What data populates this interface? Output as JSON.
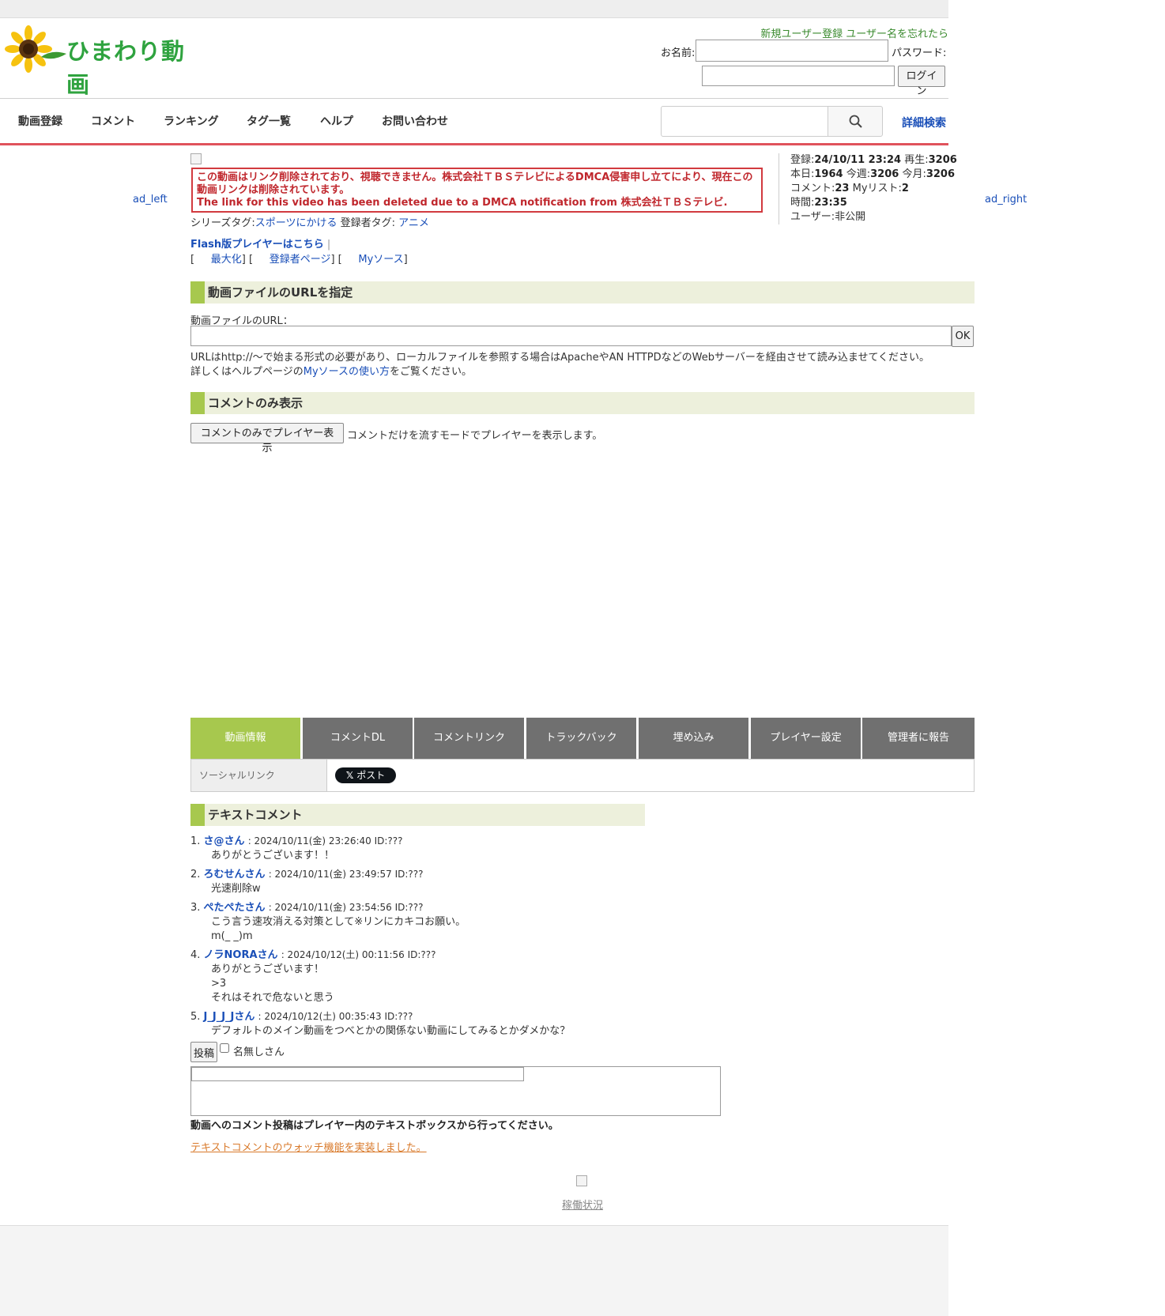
{
  "header": {
    "logo_text": "ひまわり動画",
    "register_link": "新規ユーザー登録",
    "forgot_link": "ユーザー名を忘れたら",
    "name_label": "お名前:",
    "password_label": "パスワード:",
    "login_button": "ログイン"
  },
  "nav": {
    "items": [
      "動画登録",
      "コメント",
      "ランキング",
      "タグ一覧",
      "ヘルプ",
      "お問い合わせ"
    ],
    "search_placeholder": "",
    "advanced_search": "詳細検索"
  },
  "ads": {
    "left": "ad_left",
    "right": "ad_right"
  },
  "notice": {
    "jp": "この動画はリンク削除されており、視聴できません。株式会社ＴＢＳテレビによるDMCA侵害申し立てにより、現在この動画リンクは削除されています。",
    "en": "The link for this video has been deleted due to a DMCA notification from 株式会社ＴＢＳテレビ."
  },
  "tags": {
    "series_label": "シリーズタグ:",
    "series_value": "スポーツにかける",
    "owner_label": "登録者タグ:",
    "owner_value": "アニメ"
  },
  "links": {
    "flash": "Flash版プレイヤーはこちら",
    "sep": "|",
    "maximize": "最大化",
    "owner_page": "登録者ページ",
    "mysource": "Myソース"
  },
  "stats": {
    "registered_label": "登録:",
    "registered": "24/10/11 23:24",
    "plays_label": "再生:",
    "plays": "3206",
    "today_label": "本日:",
    "today": "1964",
    "week_label": "今週:",
    "week": "3206",
    "month_label": "今月:",
    "month": "3206",
    "comments_label": "コメント:",
    "comments": "23",
    "mylist_label": "Myリスト:",
    "mylist": "2",
    "time_label": "時間:",
    "time": "23:35",
    "user_label": "ユーザー:",
    "user": "非公開"
  },
  "url_section": {
    "title": "動画ファイルのURLを指定",
    "label": "動画ファイルのURL：",
    "ok": "OK",
    "note1": "URLはhttp://～で始まる形式の必要があり、ローカルファイルを参照する場合はApacheやAN HTTPDなどのWebサーバーを経由させて読み込ませてください。",
    "note2_pre": "詳しくはヘルプページの",
    "note2_link": "Myソースの使い方",
    "note2_post": "をご覧ください。"
  },
  "comment_only": {
    "title": "コメントのみ表示",
    "button": "コメントのみでプレイヤー表示",
    "desc": "コメントだけを流すモードでプレイヤーを表示します。"
  },
  "tabs": [
    "動画情報",
    "コメントDL",
    "コメントリンク",
    "トラックバック",
    "埋め込み",
    "プレイヤー設定",
    "管理者に報告"
  ],
  "social": {
    "label": "ソーシャルリンク",
    "post_button": "ポスト"
  },
  "text_comments": {
    "title": "テキストコメント",
    "items": [
      {
        "num": "1.",
        "name": "さ@さん",
        "meta": ": 2024/10/11(金) 23:26:40 ID:???",
        "lines": [
          "ありがとうございます！！"
        ]
      },
      {
        "num": "2.",
        "name": "ろむせんさん",
        "meta": ": 2024/10/11(金) 23:49:57 ID:???",
        "lines": [
          "光速削除w"
        ]
      },
      {
        "num": "3.",
        "name": "ぺたぺたさん",
        "meta": ": 2024/10/11(金) 23:54:56 ID:???",
        "lines": [
          "こう言う速攻消える対策として※リンにカキコお願い。",
          "m(_ _)m"
        ]
      },
      {
        "num": "4.",
        "name": "ノラNORAさん",
        "meta": ": 2024/10/12(土) 00:11:56 ID:???",
        "lines": [
          "ありがとうございます！",
          ">3",
          "それはそれで危ないと思う"
        ]
      },
      {
        "num": "5.",
        "name": "J_J_J_Jさん",
        "meta": ": 2024/10/12(土) 00:35:43 ID:???",
        "lines": [
          "デフォルトのメイン動画をつべとかの関係ない動画にしてみるとかダメかな？"
        ]
      }
    ],
    "post_button": "投稿",
    "anon_label": "名無しさん",
    "note": "動画へのコメント投稿はプレイヤー内のテキストボックスから行ってください。",
    "watch_link": "テキストコメントのウォッチ機能を実装しました。"
  },
  "footer": {
    "status_link": "稼働状況"
  },
  "colors": {
    "accent_green": "#a7c84e",
    "nav_red": "#e0535c",
    "notice_red": "#c0272d",
    "link_blue": "#1a4fb8",
    "tab_gray": "#707070"
  }
}
